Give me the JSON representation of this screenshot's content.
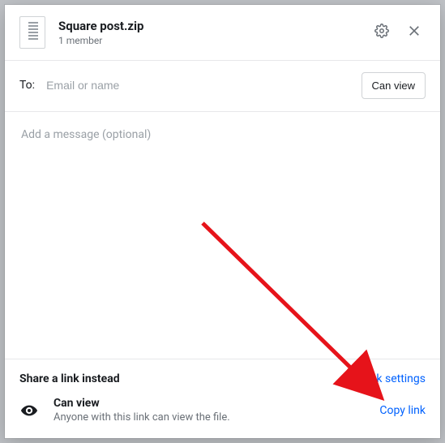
{
  "header": {
    "title": "Square post.zip",
    "subtitle": "1 member"
  },
  "to": {
    "label": "To:",
    "placeholder": "Email or name",
    "permission_button": "Can view"
  },
  "message": {
    "placeholder": "Add a message (optional)"
  },
  "link_section": {
    "share_title": "Share a link instead",
    "link_settings": "Link settings",
    "can_view_title": "Can view",
    "can_view_desc": "Anyone with this link can view the file.",
    "copy_link": "Copy link"
  },
  "colors": {
    "link": "#0061fe",
    "arrow": "#e6131a"
  }
}
